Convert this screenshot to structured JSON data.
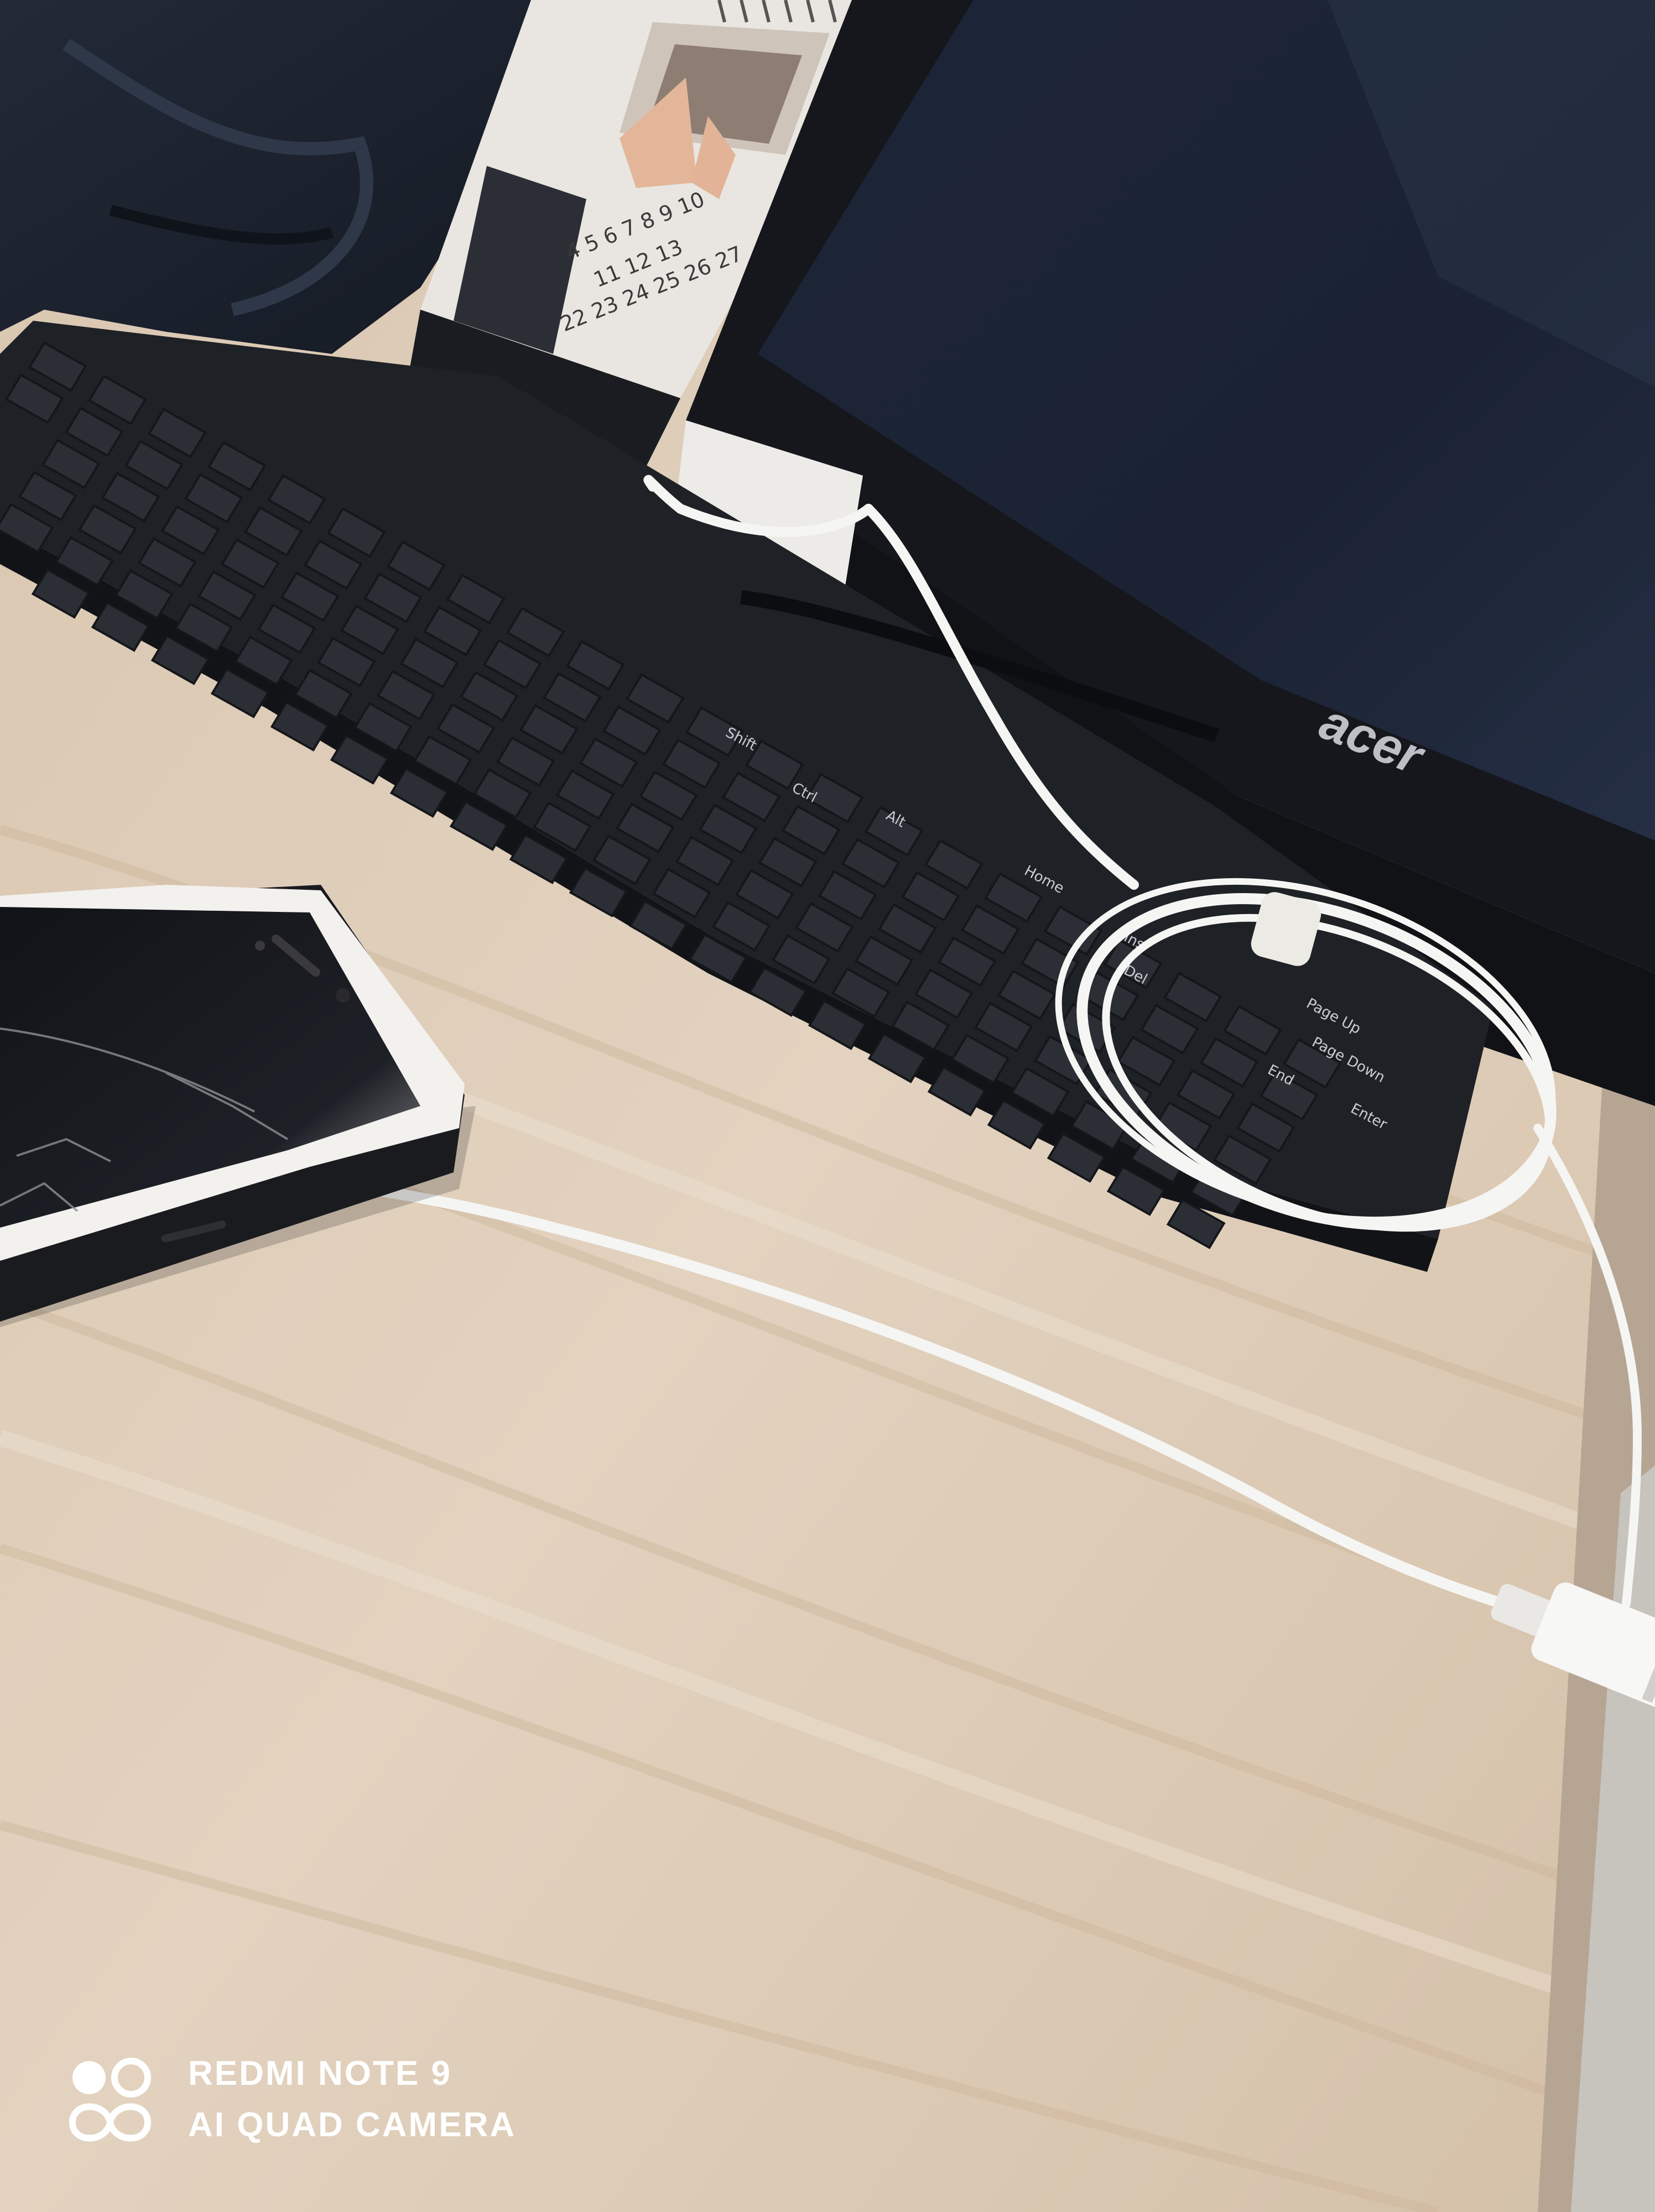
{
  "watermark": {
    "line1": "REDMI NOTE 9",
    "line2": "AI QUAD CAMERA",
    "logo_icon": "redmi-camera-logo-icon"
  },
  "monitor": {
    "brand": "acer"
  },
  "calendar": {
    "row1": [
      "4",
      "5",
      "6",
      "7",
      "8",
      "9",
      "10"
    ],
    "row2": [
      "11",
      "12",
      "13"
    ],
    "row3": [
      "22",
      "23",
      "24",
      "25",
      "26",
      "27"
    ]
  },
  "keyboard": {
    "labels": [
      "Ctrl",
      "Shift",
      "Enter",
      "Del",
      "Ins",
      "Page Up",
      "Page Down",
      "Home",
      "End",
      "Alt"
    ]
  },
  "colors": {
    "desk": "#dbc8b2",
    "desk_grain": "#cdb79d",
    "monitor_bezel": "#15171c",
    "monitor_screen": "#1b2436",
    "keyboard_body": "#1e2126",
    "key_cap": "#2b2f35",
    "cable": "#f4f4f2",
    "phone_frame": "#f3f1ee",
    "phone_screen": "#0c0d10"
  }
}
